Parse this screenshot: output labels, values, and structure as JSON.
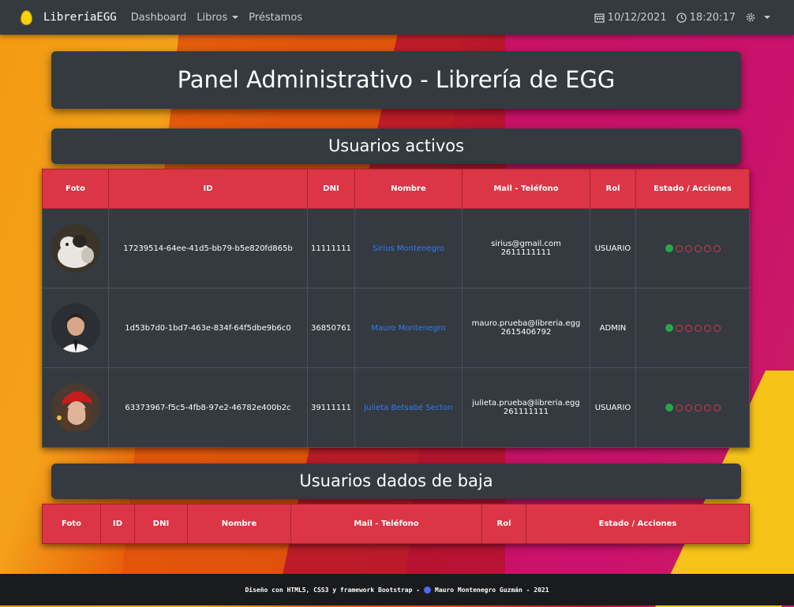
{
  "navbar": {
    "brand": "LibreríaEGG",
    "links": [
      "Dashboard",
      "Libros",
      "Préstamos"
    ],
    "date": "10/12/2021",
    "time": "18:20:17"
  },
  "title": "Panel Administrativo - Librería de EGG",
  "active_section": {
    "heading": "Usuarios activos",
    "columns": [
      "Foto",
      "ID",
      "DNI",
      "Nombre",
      "Mail - Teléfono",
      "Rol",
      "Estado / Acciones"
    ],
    "rows": [
      {
        "id": "17239514-64ee-41d5-bb79-b5e820fd865b",
        "dni": "11111111",
        "name": "Sirius Montenegro",
        "mail": "sirius@gmail.com",
        "phone": "2611111111",
        "role": "USUARIO"
      },
      {
        "id": "1d53b7d0-1bd7-463e-834f-64f5dbe9b6c0",
        "dni": "36850761",
        "name": "Mauro Montenegro",
        "mail": "mauro.prueba@libreria.egg",
        "phone": "2615406792",
        "role": "ADMIN"
      },
      {
        "id": "63373967-f5c5-4fb8-97e2-46782e400b2c",
        "dni": "39111111",
        "name": "Julieta Betsabé Secton",
        "mail": "julieta.prueba@libreria.egg",
        "phone": "261111111",
        "role": "USUARIO"
      }
    ]
  },
  "inactive_section": {
    "heading": "Usuarios dados de baja",
    "columns": [
      "Foto",
      "ID",
      "DNI",
      "Nombre",
      "Mail - Teléfono",
      "Rol",
      "Estado / Acciones"
    ]
  },
  "footer": {
    "left": "Diseño con HTML5, CSS3 y framework Bootstrap -",
    "right": "Mauro Montenegro Guzmán - 2021"
  },
  "colors": {
    "header_red": "#dc3545",
    "panel_dark": "#343a40",
    "link_blue": "#2f7cf6",
    "status_green": "#28a745"
  },
  "icons": [
    "calendar-icon",
    "clock-icon",
    "gear-icon",
    "status-active-icon",
    "download-icon",
    "upload-icon",
    "view-icon",
    "user-role-icon",
    "delete-icon",
    "github-icon"
  ]
}
